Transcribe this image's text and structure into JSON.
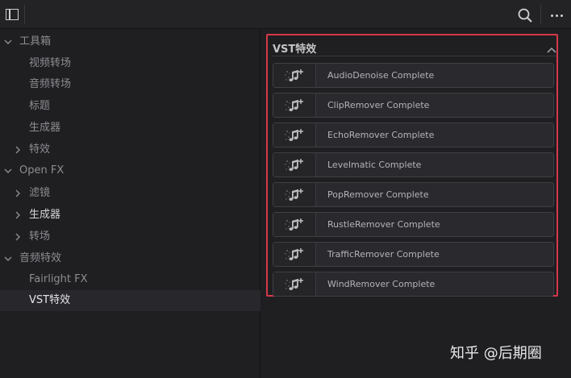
{
  "toolbar": {
    "sidebar_toggle_icon": "sidebar-toggle-icon",
    "search_icon": "search-icon",
    "more_icon": "more-icon"
  },
  "tree": [
    {
      "label": "工具箱",
      "level": 0,
      "chevron": "down"
    },
    {
      "label": "视频转场",
      "level": 1
    },
    {
      "label": "音频转场",
      "level": 1
    },
    {
      "label": "标题",
      "level": 1
    },
    {
      "label": "生成器",
      "level": 1
    },
    {
      "label": "特效",
      "level": 1,
      "chevron": "right"
    },
    {
      "label": "Open FX",
      "level": 0,
      "chevron": "down"
    },
    {
      "label": "滤镜",
      "level": 1,
      "chevron": "right"
    },
    {
      "label": "生成器",
      "level": 1,
      "chevron": "right",
      "bright": true
    },
    {
      "label": "转场",
      "level": 1,
      "chevron": "right"
    },
    {
      "label": "音频特效",
      "level": 0,
      "chevron": "down"
    },
    {
      "label": "Fairlight FX",
      "level": 1
    },
    {
      "label": "VST特效",
      "level": 1,
      "selected": true
    }
  ],
  "vst_panel": {
    "title": "VST特效",
    "collapse_icon": "chevron-up-icon",
    "items": [
      "AudioDenoise Complete",
      "ClipRemover Complete",
      "EchoRemover Complete",
      "Levelmatic Complete",
      "PopRemover Complete",
      "RustleRemover Complete",
      "TrafficRemover Complete",
      "WindRemover Complete"
    ],
    "item_icon": "music-note-icon",
    "highlight_color": "#d8384a"
  },
  "watermark": "知乎 @后期圈"
}
